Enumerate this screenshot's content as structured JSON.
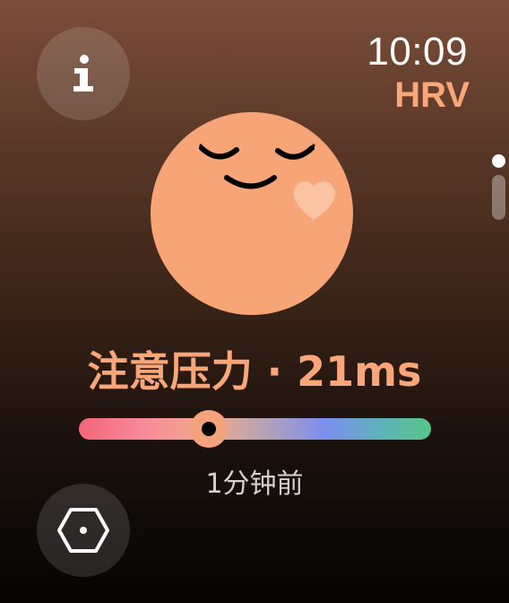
{
  "header": {
    "time": "10:09",
    "app_title": "HRV"
  },
  "icons": {
    "info": "info-icon",
    "measure": "hexagon-dot-icon",
    "mood": "relaxed-face-icon"
  },
  "status": {
    "text": "注意压力 · 21ms"
  },
  "stress_level": {
    "value_fraction": 0.37
  },
  "timestamp": "1分钟前",
  "colors": {
    "accent": "#fba679",
    "face": "#f7a476",
    "heart": "#fbc2a3",
    "scale_start": "#f5647a",
    "scale_mid": "#7c8ef0",
    "scale_end": "#55c788"
  }
}
